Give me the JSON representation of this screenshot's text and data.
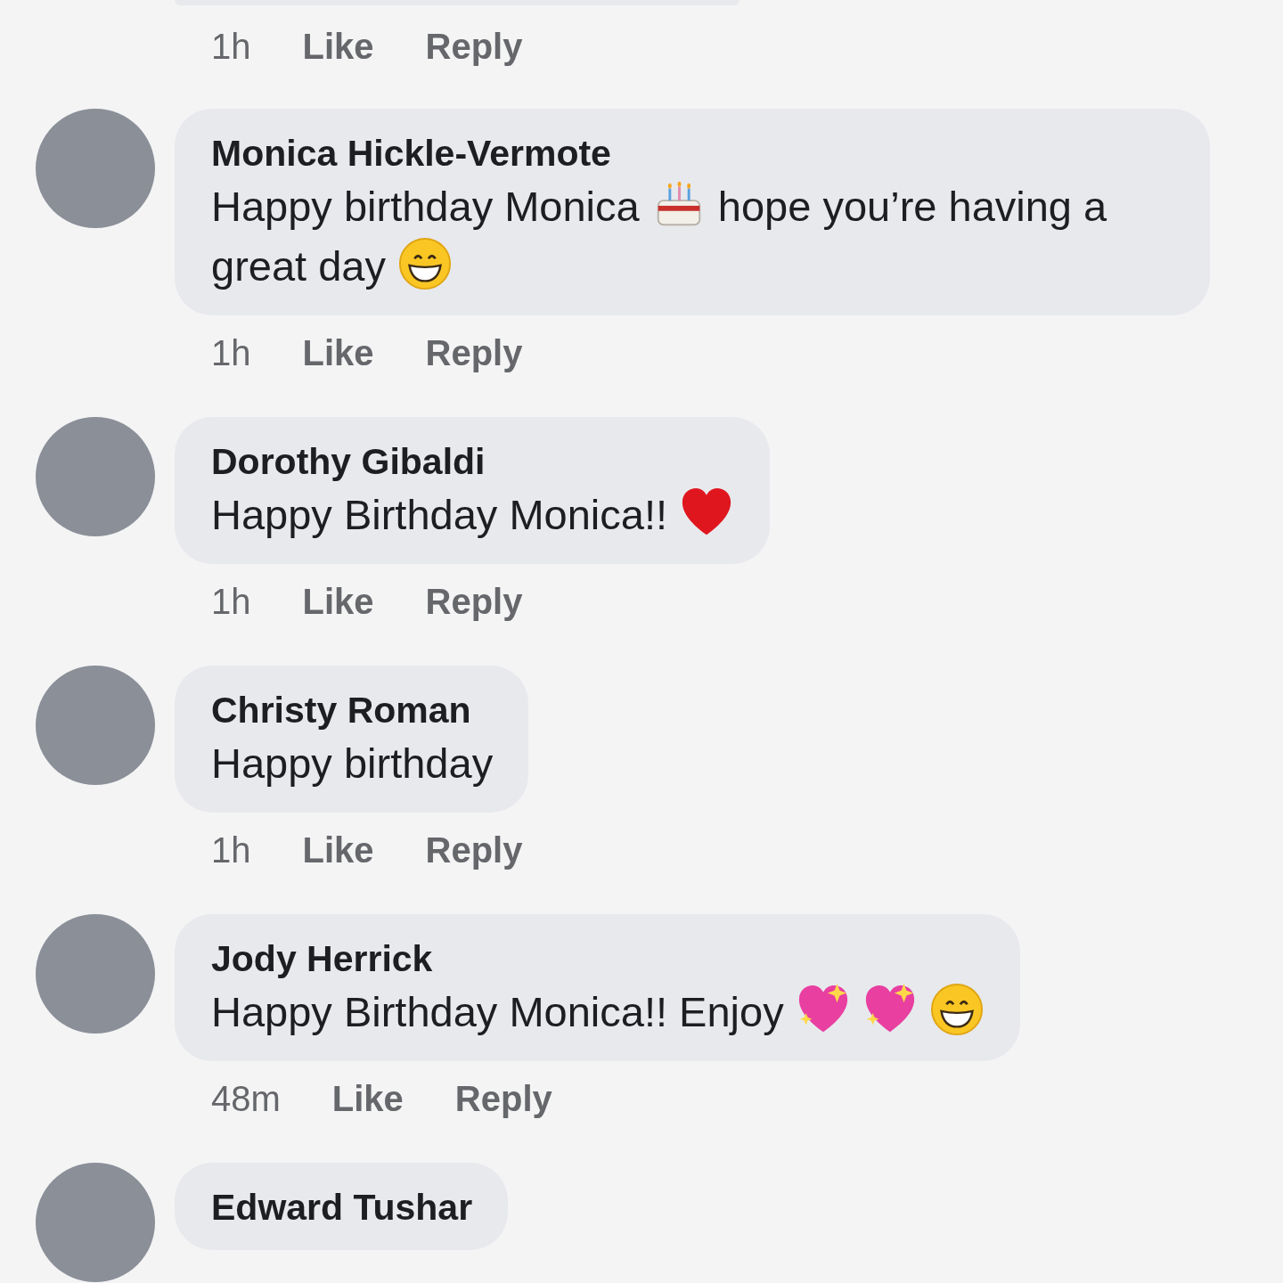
{
  "partial_comment_above": {
    "time": "1h",
    "actions": [
      "Like",
      "Reply"
    ]
  },
  "comments": [
    {
      "author": "Monica Hickle-Vermote",
      "body": [
        {
          "kind": "text",
          "text": "Happy birthday Monica"
        },
        {
          "kind": "cake"
        },
        {
          "kind": "text",
          "text": "hope you’re having a"
        },
        {
          "kind": "text",
          "text": "great day"
        },
        {
          "kind": "grin"
        }
      ],
      "time": "1h",
      "actions": [
        "Like",
        "Reply"
      ]
    },
    {
      "author": "Dorothy Gibaldi",
      "body": [
        {
          "kind": "text",
          "text": "Happy Birthday Monica!!"
        },
        {
          "kind": "heart"
        }
      ],
      "time": "1h",
      "actions": [
        "Like",
        "Reply"
      ]
    },
    {
      "author": "Christy Roman",
      "body": [
        {
          "kind": "text",
          "text": "Happy birthday"
        }
      ],
      "time": "1h",
      "actions": [
        "Like",
        "Reply"
      ]
    },
    {
      "author": "Jody Herrick",
      "body": [
        {
          "kind": "text",
          "text": "Happy Birthday Monica!! Enjoy"
        },
        {
          "kind": "sparkleheart"
        },
        {
          "kind": "sparkleheart"
        },
        {
          "kind": "grin"
        }
      ],
      "time": "48m",
      "actions": [
        "Like",
        "Reply"
      ]
    },
    {
      "author": "Edward Tushar"
    }
  ]
}
